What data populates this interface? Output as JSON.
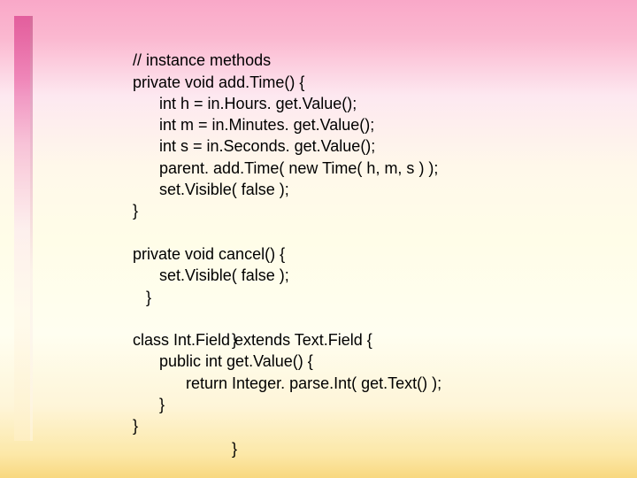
{
  "code": {
    "l1": "// instance methods",
    "l2": "private void add.Time() {",
    "l3": "      int h = in.Hours. get.Value();",
    "l4": "      int m = in.Minutes. get.Value();",
    "l5": "      int s = in.Seconds. get.Value();",
    "l6": "      parent. add.Time( new Time( h, m, s ) );",
    "l7": "      set.Visible( false );",
    "l8": "}",
    "l9": "private void cancel() {",
    "l10": "      set.Visible( false );",
    "l11": "   }",
    "l12": "}",
    "l13": "class Int.Field extends Text.Field {",
    "l14": "      public int get.Value() {",
    "l15": "            return Integer. parse.Int( get.Text() );",
    "l16": "      }",
    "l17": "}",
    "l18": "}"
  }
}
